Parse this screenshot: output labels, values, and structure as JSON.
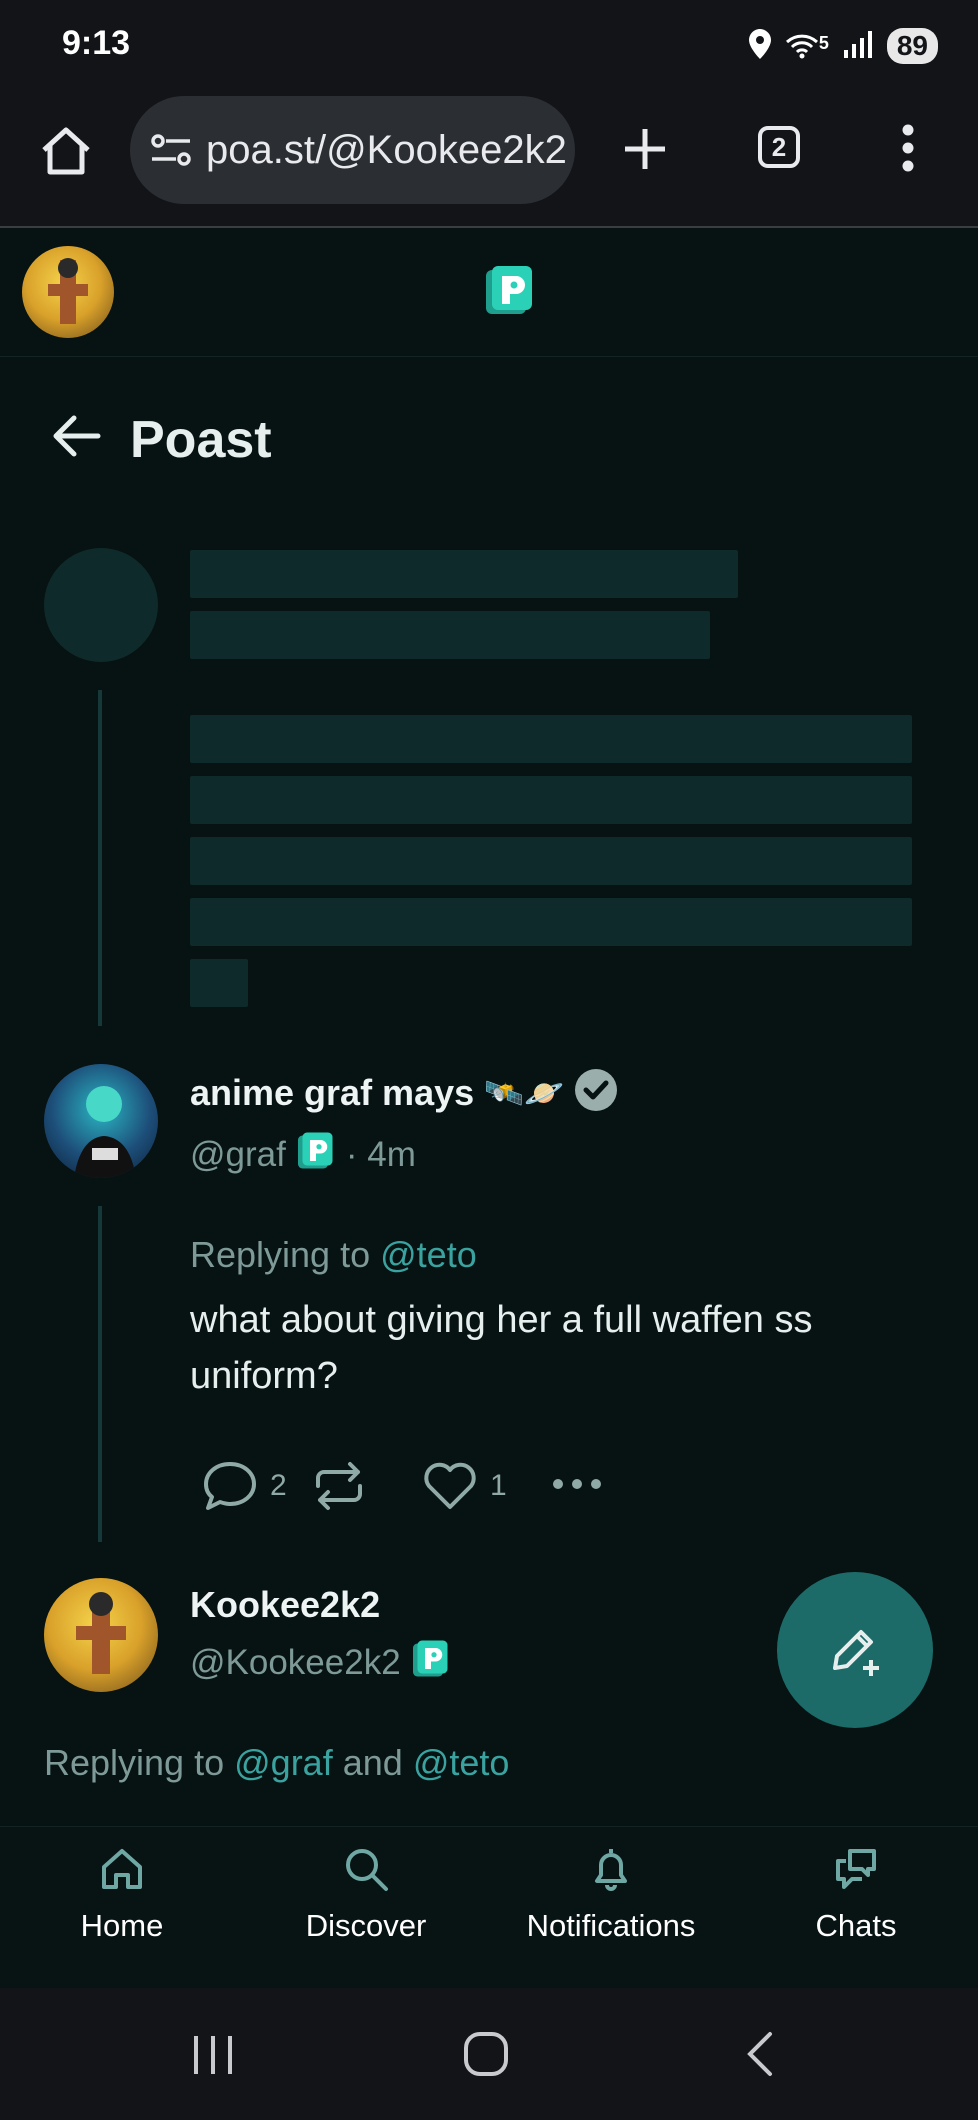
{
  "status_bar": {
    "time": "9:13",
    "battery": "89",
    "wifi_label": "5"
  },
  "browser": {
    "url": "poa.st/@Kookee2k2",
    "tab_count": "2"
  },
  "page": {
    "title": "Poast"
  },
  "posts": [
    {
      "display_name": "anime graf mays",
      "name_emoji": "🛰️🪐",
      "handle": "@graf",
      "time": "· 4m",
      "reply_prefix": "Replying to",
      "reply_mention": "@teto",
      "body": "what about giving her a full waffen ss uniform?",
      "reply_count": "2",
      "like_count": "1"
    },
    {
      "display_name": "Kookee2k2",
      "handle": "@Kookee2k2",
      "reply_prefix": "Replying to",
      "reply_mention_1": "@graf",
      "reply_joiner": "and",
      "reply_mention_2": "@teto"
    }
  ],
  "bottom_nav": [
    {
      "label": "Home",
      "icon": "home-icon"
    },
    {
      "label": "Discover",
      "icon": "search-icon"
    },
    {
      "label": "Notifications",
      "icon": "bell-icon"
    },
    {
      "label": "Chats",
      "icon": "chat-icon"
    }
  ],
  "colors": {
    "background": "#071212",
    "accent": "#3aa3a0",
    "fab": "#1c6b69"
  }
}
